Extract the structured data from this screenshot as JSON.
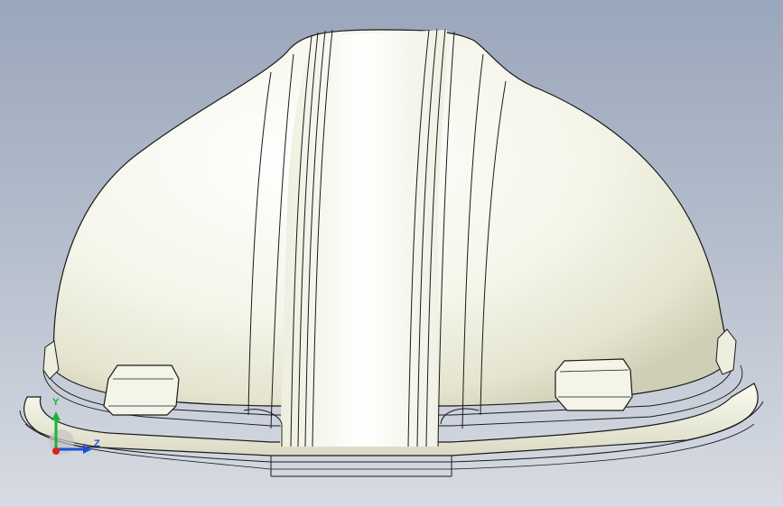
{
  "viewport": {
    "background_top": "#9aa6bb",
    "background_bottom": "#d7dbe3"
  },
  "model": {
    "shell_color": "#f3f3e6",
    "edge_color": "#1a1a1a"
  },
  "triad": {
    "x_axis_color": "#e02020",
    "y_axis_color": "#19b33a",
    "z_axis_color": "#1f4fd6",
    "y_label": "Y",
    "z_label": "Z"
  }
}
